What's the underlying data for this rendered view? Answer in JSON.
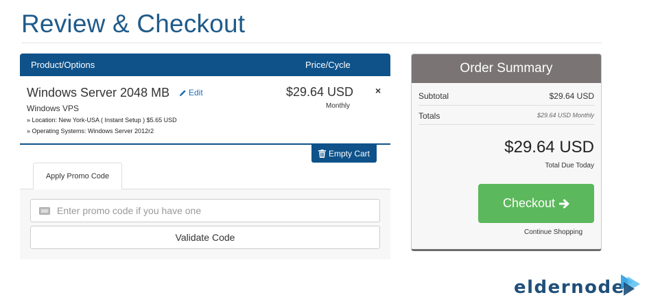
{
  "page": {
    "title": "Review & Checkout"
  },
  "cart": {
    "header": {
      "product": "Product/Options",
      "price": "Price/Cycle"
    },
    "item": {
      "name": "Windows Server 2048 MB",
      "edit_label": "Edit",
      "group": "Windows VPS",
      "options": [
        "» Location: New York-USA ( Instant Setup ) $5.65 USD",
        "» Operating Systems: Windows Server 2012r2"
      ],
      "price": "$29.64 USD",
      "cycle": "Monthly",
      "remove_symbol": "×"
    },
    "empty_cart_label": "Empty Cart"
  },
  "promo": {
    "tab_label": "Apply Promo Code",
    "input_placeholder": "Enter promo code if you have one",
    "input_value": "",
    "validate_label": "Validate Code"
  },
  "summary": {
    "title": "Order Summary",
    "subtotal_label": "Subtotal",
    "subtotal_value": "$29.64 USD",
    "totals_label": "Totals",
    "totals_value": "$29.64 USD Monthly",
    "total_amount": "$29.64 USD",
    "total_due_label": "Total Due Today",
    "checkout_label": "Checkout",
    "continue_label": "Continue Shopping"
  },
  "logo": {
    "text": "eldernode"
  },
  "colors": {
    "title": "#1f5b8a",
    "primary": "#0e5289",
    "summary_header": "#7a7574",
    "checkout": "#5cb85c"
  },
  "icons": {
    "edit": "pencil-icon",
    "empty_cart": "trash-icon",
    "remove": "close-icon",
    "promo_input": "ticket-icon",
    "checkout": "arrow-right-icon"
  }
}
